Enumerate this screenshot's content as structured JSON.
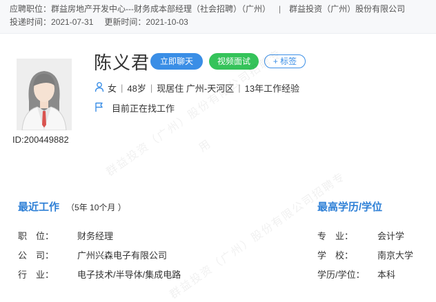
{
  "header": {
    "applied_label": "应聘职位：",
    "applied_position": "群益房地产开发中心---财务成本部经理（社会招聘）（广州）",
    "separator": "|",
    "company": "群益投资（广州）股份有限公司",
    "submit_label": "投递时间：",
    "submit_date": "2021-07-31",
    "update_label": "更新时间：",
    "update_date": "2021-10-03"
  },
  "candidate": {
    "name": "陈义君",
    "id_text": "ID:200449882",
    "gender": "女",
    "age": "48岁",
    "residence": "现居住 广州-天河区",
    "experience": "13年工作经验",
    "status": "目前正在找工作"
  },
  "actions": {
    "chat": "立即聊天",
    "video": "视频面试",
    "tag": "+ 标签"
  },
  "recent_work": {
    "title": "最近工作",
    "duration": "（5年 10个月 ）",
    "position_label": "职　位：",
    "position": "财务经理",
    "company_label": "公　司：",
    "company": "广州兴森电子有限公司",
    "industry_label": "行　业：",
    "industry": "电子技术/半导体/集成电路"
  },
  "education": {
    "title": "最高学历/学位",
    "major_label": "专　业：",
    "major": "会计学",
    "school_label": "学　校：",
    "school": "南京大学",
    "degree_label": "学历/学位：",
    "degree": "本科"
  },
  "watermarks": {
    "line_a": "群益投资（广州）股份有限公司招聘专",
    "line_b": "用"
  },
  "colors": {
    "accent_blue": "#3a8ee6",
    "accent_green": "#35c35a",
    "section_title": "#2d7fd6"
  }
}
